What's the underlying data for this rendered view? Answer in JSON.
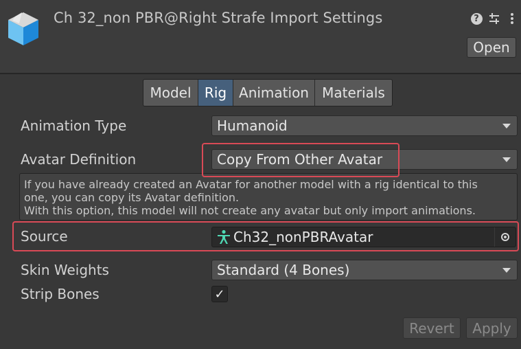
{
  "header": {
    "title": "Ch 32_non PBR@Right Strafe Import Settings",
    "open_label": "Open",
    "icons": [
      "help-icon",
      "presets-icon",
      "more-options-icon"
    ]
  },
  "tabs": [
    {
      "label": "Model",
      "active": false
    },
    {
      "label": "Rig",
      "active": true
    },
    {
      "label": "Animation",
      "active": false
    },
    {
      "label": "Materials",
      "active": false
    }
  ],
  "fields": {
    "animation_type": {
      "label": "Animation Type",
      "value": "Humanoid"
    },
    "avatar_definition": {
      "label": "Avatar Definition",
      "value": "Copy From Other Avatar"
    },
    "help_lines": [
      "If you have already created an Avatar for another model with a rig identical to this",
      "one, you can copy its Avatar definition.",
      "With this option, this model will not create any avatar but only import animations."
    ],
    "source": {
      "label": "Source",
      "value": "Ch32_nonPBRAvatar"
    },
    "skin_weights": {
      "label": "Skin Weights",
      "value": "Standard (4 Bones)"
    },
    "strip_bones": {
      "label": "Strip Bones",
      "checked": true,
      "check_glyph": "✓"
    }
  },
  "footer": {
    "revert_label": "Revert",
    "apply_label": "Apply"
  },
  "colors": {
    "accent_tab": "#46607c",
    "highlight": "#d94a56",
    "avatar_icon": "#4fd8b4"
  }
}
